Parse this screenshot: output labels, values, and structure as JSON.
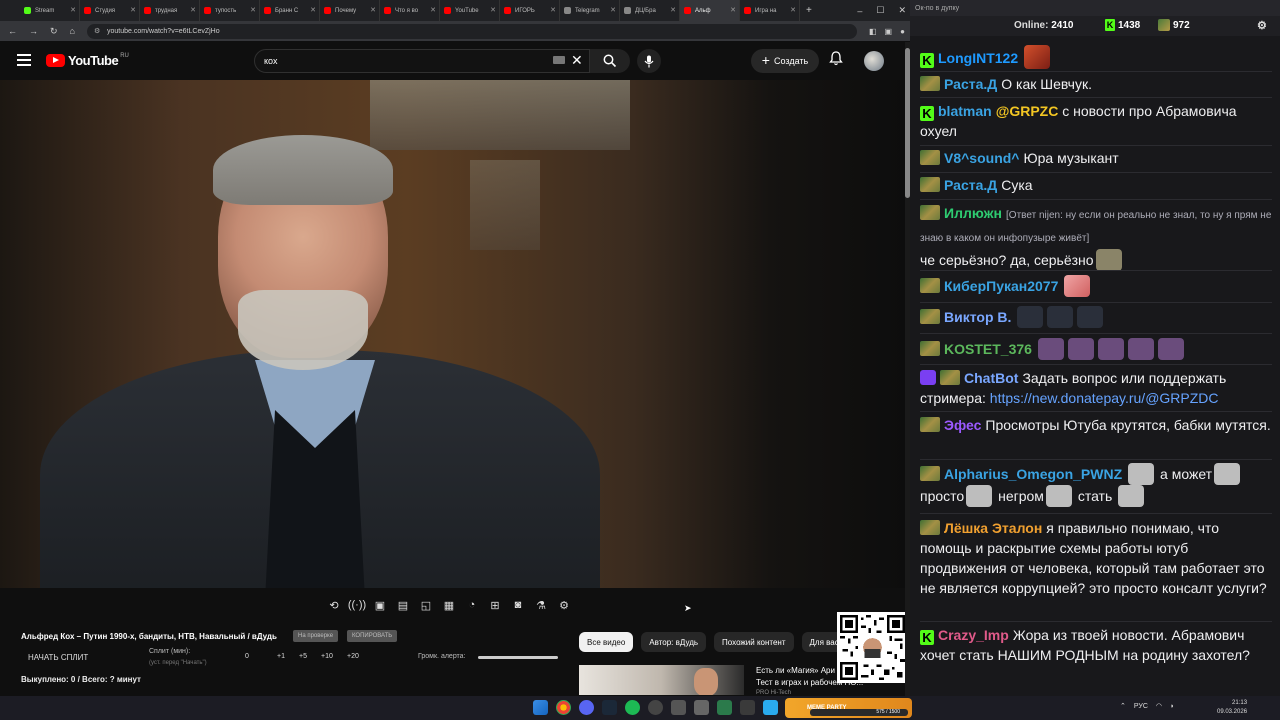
{
  "browser": {
    "tabs": [
      {
        "label": "Stream",
        "color": "#53fc18"
      },
      {
        "label": "Студия",
        "color": "#ff0000"
      },
      {
        "label": "трудная",
        "color": "#ff0000"
      },
      {
        "label": "тупость",
        "color": "#ff0000"
      },
      {
        "label": "Бранн С",
        "color": "#ff0000"
      },
      {
        "label": "Почему",
        "color": "#ff0000"
      },
      {
        "label": "Что я во",
        "color": "#ff0000"
      },
      {
        "label": "YouTube",
        "color": "#ff0000"
      },
      {
        "label": "ИГОРЬ",
        "color": "#ff0000"
      },
      {
        "label": "Telegram",
        "color": "#888888"
      },
      {
        "label": "ДЦ/Бра",
        "color": "#888888"
      },
      {
        "label": "Альф",
        "color": "#ff0000"
      },
      {
        "label": "Игра на",
        "color": "#ff0000"
      }
    ],
    "url": "youtube.com/watch?v=e6tLCevZjHo"
  },
  "youtube": {
    "logo_text": "YouTube",
    "country": "RU",
    "search_value": "кох",
    "create_label": "Создать"
  },
  "player": {
    "title": "Альфред Кох – Путин 1990-х, бандиты, НТВ, Навальный / вДудь",
    "tag_on_air": "На проверке",
    "tag_copy": "КОПИРОВАТЬ",
    "start_split": "НАЧАТЬ СПЛИТ",
    "split_label": "Сплит (мин):",
    "split_hint": "(уст. перед \"Начать\")",
    "split_values": [
      "0",
      "+1",
      "+5",
      "+10",
      "+20"
    ],
    "volume_label": "Громк. алерта:",
    "bought": "Выкуплено: 0 / Всего: ? минут"
  },
  "recommend": {
    "chips": [
      "Все видео",
      "Автор: вДудь",
      "Похожий контент",
      "Для вас"
    ],
    "item_title_1": "Есть ли «Магия» Ари",
    "item_title_2": "Тест в играх и рабочем ПО...",
    "item_meta": "PRO Hi-Tech"
  },
  "chat": {
    "window_title": "Ок-по в дупку",
    "online_label": "Online:",
    "online_value": "2410",
    "kick_count": "1438",
    "twitch_count": "972",
    "messages": [
      {
        "user": "LongINT122",
        "color": "#1e9aff",
        "text": ""
      },
      {
        "user": "Раста.Д",
        "color": "#3aa3e3",
        "text": "О как Шевчук."
      },
      {
        "user": "blatman",
        "color": "#3aa3e3",
        "mention": "@GRPZC",
        "text": "с новости про Абрамовича охуел"
      },
      {
        "user": "V8^sound^",
        "color": "#3aa3e3",
        "text": "Юра музыкант"
      },
      {
        "user": "Раста.Д",
        "color": "#3aa3e3",
        "text": "Сука"
      },
      {
        "user": "Иллюжн",
        "color": "#2ecc71",
        "reply": "[Ответ nijen: ну если он реально не знал, то ну я прям не знаю в каком он инфопузыре живёт]",
        "text": "че серьёзно? да, серьёзно"
      },
      {
        "user": "КиберПукан2077",
        "color": "#3aa3e3",
        "text": ""
      },
      {
        "user": "Виктор В.",
        "color": "#7aa7ff",
        "text": ""
      },
      {
        "user": "KOSTET_376",
        "color": "#5cb85c",
        "text": ""
      },
      {
        "user": "ChatBot",
        "color": "#7aa7ff",
        "text": "Задать вопрос или поддержать стримера:",
        "link": "https://new.donatepay.ru/@GRPZDC"
      },
      {
        "user": "Эфес",
        "color": "#9b59ff",
        "text": "Просмотры Ютуба крутятся, бабки мутятся."
      },
      {
        "user": "Alpharius_Omegon_PWNZ",
        "color": "#3aa3e3",
        "text1": "а может",
        "text2": "просто",
        "text3": "негром",
        "text4": "стать"
      },
      {
        "user": "Лёшка Эталон",
        "color": "#f0a030",
        "text": "я правильно понимаю, что помощь и раскрытие схемы работы ютуб продвижения от человека, который там работает это не является коррупцией? это просто консалт услуги?"
      },
      {
        "user": "Crazy_Imp",
        "color": "#e05a8a",
        "text": "Жора из твоей новости. Абрамович хочет стать НАШИМ РОДНЫМ на родину захотел?"
      }
    ]
  },
  "taskbar": {
    "meme_label": "MEME PARTY",
    "meme_progress": "575 / 1500",
    "lang": "РУС",
    "time": "21:13",
    "date": "09.03.2026"
  }
}
